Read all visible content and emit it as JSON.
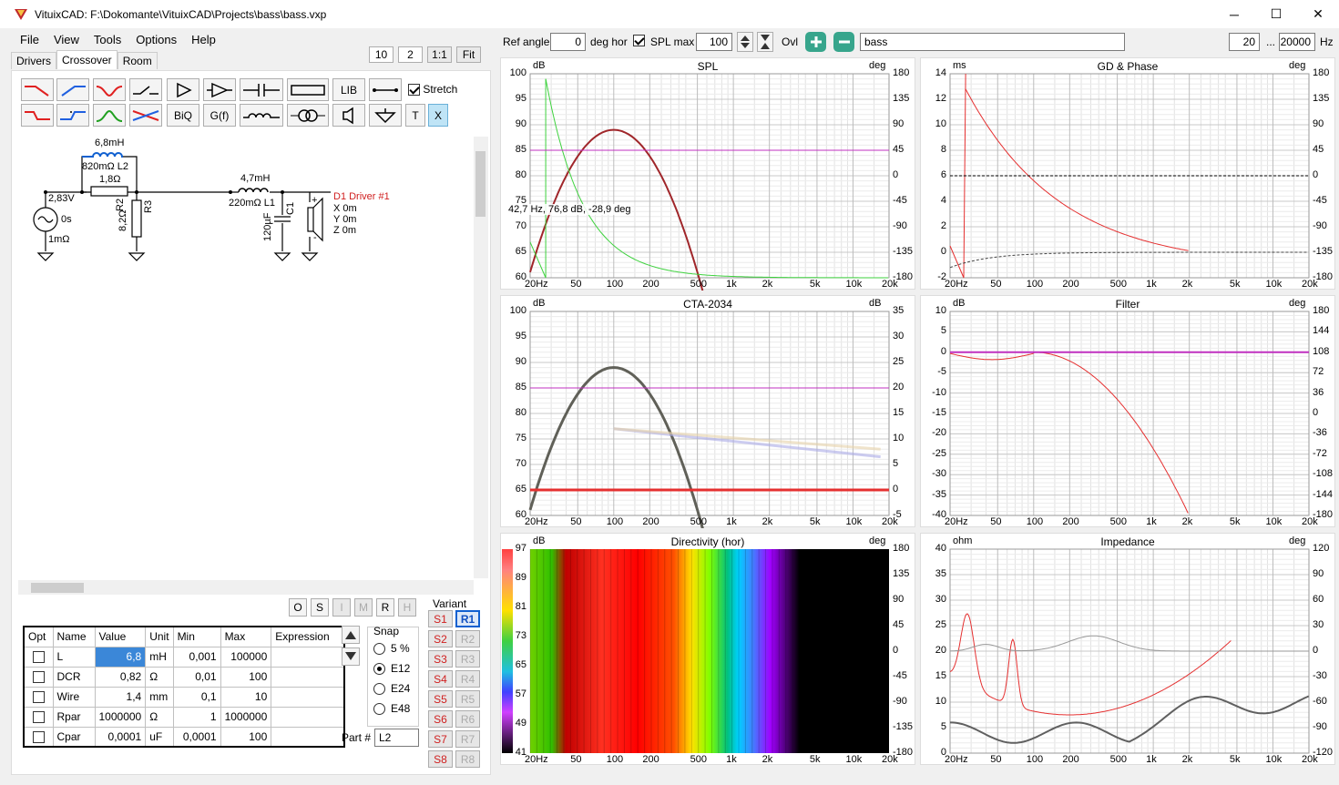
{
  "window": {
    "title": "VituixCAD: F:\\Dokomante\\VituixCAD\\Projects\\bass\\bass.vxp",
    "minimize": "─",
    "maximize": "☐",
    "close": "✕"
  },
  "menu": [
    "File",
    "View",
    "Tools",
    "Options",
    "Help"
  ],
  "tabs": [
    "Drivers",
    "Crossover",
    "Room"
  ],
  "zoom": {
    "a": "10",
    "b": "2",
    "c": "1:1",
    "d": "Fit"
  },
  "toolbar": {
    "lib": "LIB",
    "biq": "BiQ",
    "gf": "G(f)",
    "stretch": "Stretch",
    "t": "T",
    "x": "X"
  },
  "schematic": {
    "l2_value": "6,8mH",
    "l2_label": "820mΩ L2",
    "r2_value": "1,8Ω",
    "r2_label": "R2",
    "r3_value": "8,2Ω",
    "r3_label": "R3",
    "src_v": "2,83V",
    "src_phase": "0s",
    "src_r": "1mΩ",
    "l1_value": "4,7mH",
    "l1_label": "220mΩ L1",
    "c1_value": "120µF",
    "c1_label": "C1",
    "driver_name": "D1 Driver #1",
    "driver_x": "X 0m",
    "driver_y": "Y 0m",
    "driver_z": "Z 0m",
    "plus": "+",
    "minus": "-"
  },
  "osr": [
    "O",
    "S",
    "I",
    "M",
    "R",
    "H"
  ],
  "param_table": {
    "headers": [
      "Opt",
      "Name",
      "Value",
      "Unit",
      "Min",
      "Max",
      "Expression"
    ],
    "rows": [
      {
        "name": "L",
        "value": "6,8",
        "unit": "mH",
        "min": "0,001",
        "max": "100000"
      },
      {
        "name": "DCR",
        "value": "0,82",
        "unit": "Ω",
        "min": "0,01",
        "max": "100"
      },
      {
        "name": "Wire",
        "value": "1,4",
        "unit": "mm",
        "min": "0,1",
        "max": "10"
      },
      {
        "name": "Rpar",
        "value": "1000000",
        "unit": "Ω",
        "min": "1",
        "max": "1000000"
      },
      {
        "name": "Cpar",
        "value": "0,0001",
        "unit": "uF",
        "min": "0,0001",
        "max": "100"
      }
    ]
  },
  "snap": {
    "title": "Snap",
    "options": [
      "5 %",
      "E12",
      "E24",
      "E48"
    ],
    "selected": "E12"
  },
  "part": {
    "label": "Part #",
    "value": "L2"
  },
  "variant": {
    "title": "Variant",
    "s": [
      "S1",
      "S2",
      "S3",
      "S4",
      "S5",
      "S6",
      "S7",
      "S8"
    ],
    "r": [
      "R1",
      "R2",
      "R3",
      "R4",
      "R5",
      "R6",
      "R7",
      "R8"
    ]
  },
  "top": {
    "ref_angle_label": "Ref angle",
    "ref_angle": "0",
    "deg_hor": "deg hor",
    "spl_max_label": "SPL max",
    "spl_max": "100",
    "ovl": "Ovl",
    "overlay_name": "bass",
    "f_min": "20",
    "dots": "...",
    "f_max": "20000",
    "hz": "Hz"
  },
  "freq_ticks": [
    "20Hz",
    "50",
    "100",
    "200",
    "500",
    "1k",
    "2k",
    "5k",
    "10k",
    "20k"
  ],
  "graphs": {
    "spl": {
      "title": "SPL",
      "lunit": "dB",
      "runit": "deg",
      "left": [
        "100",
        "95",
        "90",
        "85",
        "80",
        "75",
        "70",
        "65",
        "60"
      ],
      "right": [
        "180",
        "135",
        "90",
        "45",
        "0",
        "-45",
        "-90",
        "-135",
        "-180"
      ],
      "cursor": "42,7 Hz, 76,8 dB, -28,9 deg"
    },
    "gd": {
      "title": "GD & Phase",
      "lunit": "ms",
      "runit": "deg",
      "left": [
        "14",
        "12",
        "10",
        "8",
        "6",
        "4",
        "2",
        "0",
        "-2"
      ],
      "right": [
        "180",
        "135",
        "90",
        "45",
        "0",
        "-45",
        "-90",
        "-135",
        "-180"
      ]
    },
    "cta": {
      "title": "CTA-2034",
      "lunit": "dB",
      "runit": "dB",
      "left": [
        "100",
        "95",
        "90",
        "85",
        "80",
        "75",
        "70",
        "65",
        "60"
      ],
      "right": [
        "35",
        "30",
        "25",
        "20",
        "15",
        "10",
        "5",
        "0",
        "-5"
      ]
    },
    "filter": {
      "title": "Filter",
      "lunit": "dB",
      "runit": "deg",
      "left": [
        "10",
        "5",
        "0",
        "-5",
        "-10",
        "-15",
        "-20",
        "-25",
        "-30",
        "-35",
        "-40"
      ],
      "right": [
        "180",
        "144",
        "108",
        "72",
        "36",
        "0",
        "-36",
        "-72",
        "-108",
        "-144",
        "-180"
      ]
    },
    "dir": {
      "title": "Directivity (hor)",
      "lunit": "dB",
      "runit": "deg",
      "left": [
        "97",
        "89",
        "81",
        "73",
        "65",
        "57",
        "49",
        "41"
      ],
      "right": [
        "180",
        "135",
        "90",
        "45",
        "0",
        "-45",
        "-90",
        "-135",
        "-180"
      ]
    },
    "imp": {
      "title": "Impedance",
      "lunit": "ohm",
      "runit": "deg",
      "left": [
        "40",
        "35",
        "30",
        "25",
        "20",
        "15",
        "10",
        "5",
        "0"
      ],
      "right": [
        "120",
        "90",
        "60",
        "30",
        "0",
        "-30",
        "-60",
        "-90",
        "-120"
      ]
    }
  },
  "colors": {
    "accent": "#0078d7",
    "spl": "#a0262a",
    "green": "#3ed23e",
    "magenta": "#c030c0",
    "red": "#e53030",
    "gray": "#606058"
  }
}
